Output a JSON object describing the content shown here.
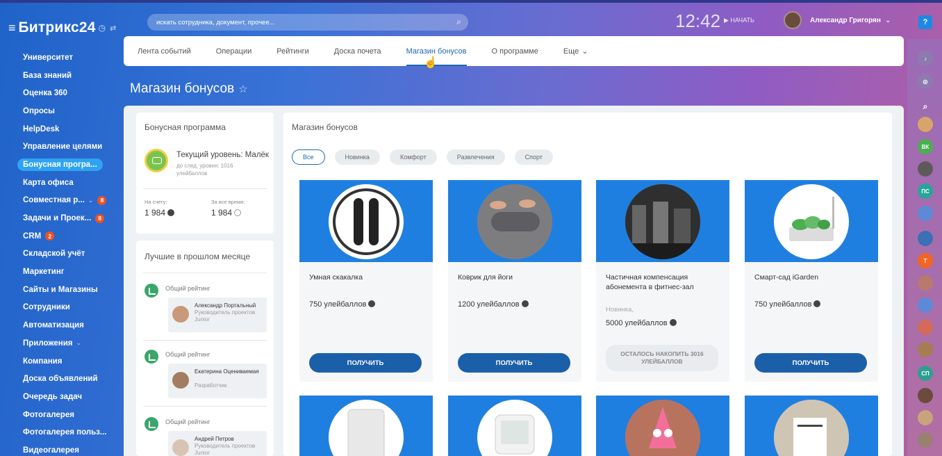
{
  "app": {
    "brand": "Битрикс24",
    "time": "12:42",
    "start_label": "НАЧАТЬ",
    "user_name": "Александр Григорян"
  },
  "search": {
    "placeholder": "искать сотрудника, документ, прочее..."
  },
  "sidebar": {
    "items": [
      {
        "label": "Университет"
      },
      {
        "label": "База знаний"
      },
      {
        "label": "Оценка 360"
      },
      {
        "label": "Опросы"
      },
      {
        "label": "HelpDesk"
      },
      {
        "label": "Управление целями"
      },
      {
        "label": "Бонусная програ..."
      },
      {
        "label": "Карта офиса"
      },
      {
        "label": "Совместная р...",
        "badge": "8"
      },
      {
        "label": "Задачи и Проек...",
        "badge": "8"
      },
      {
        "label": "CRM",
        "badge": "2"
      },
      {
        "label": "Складской учёт"
      },
      {
        "label": "Маркетинг"
      },
      {
        "label": "Сайты и Магазины"
      },
      {
        "label": "Сотрудники"
      },
      {
        "label": "Автоматизация"
      },
      {
        "label": "Приложения"
      },
      {
        "label": "Компания"
      },
      {
        "label": "Доска объявлений"
      },
      {
        "label": "Очередь задач"
      },
      {
        "label": "Фотогалерея"
      },
      {
        "label": "Фотогалерея польз..."
      },
      {
        "label": "Видеогалерея"
      }
    ]
  },
  "tabs": [
    "Лента событий",
    "Операции",
    "Рейтинги",
    "Доска почета",
    "Магазин бонусов",
    "О программе",
    "Еще"
  ],
  "page_title": "Магазин бонусов",
  "bonus": {
    "title": "Бонусная программа",
    "level": "Текущий уровень: Малёк",
    "level_sub": "до след. уровня: 1016 улейбаллов",
    "balance_label": "На счету:",
    "balance": "1 984",
    "total_label": "За все время:",
    "total": "1 984"
  },
  "best": {
    "title": "Лучшие в прошлом месяце",
    "items": [
      {
        "type": "Общий рейтинг",
        "name": "Александр Портальный",
        "position": "Руководитель проектов Junior"
      },
      {
        "type": "Общий рейтинг",
        "name": "Екатерина Оцениваемая",
        "position": "Разработчик"
      },
      {
        "type": "Общий рейтинг",
        "name": "Андрей Петров",
        "position": "Руководитель проектов Junior"
      }
    ]
  },
  "shop": {
    "title": "Магазин бонусов",
    "filters": [
      "Все",
      "Новинка",
      "Комфорт",
      "Развлечения",
      "Спорт"
    ],
    "products": [
      {
        "name": "Умная скакалка",
        "price": "750 улейбаллов",
        "button": "ПОЛУЧИТЬ"
      },
      {
        "name": "Коврик для йоги",
        "price": "1200 улейбаллов",
        "button": "ПОЛУЧИТЬ"
      },
      {
        "name": "Частичная компенсация абонемента в фитнес-зал",
        "tag": "Новинка,",
        "price": "5000 улейбаллов",
        "button": "ОСТАЛОСЬ НАКОПИТЬ 3016 УЛЕЙБАЛЛОВ"
      },
      {
        "name": "Смарт-сад iGarden",
        "price": "750 улейбаллов",
        "button": "ПОЛУЧИТЬ"
      }
    ]
  },
  "rail_labels": [
    "ВК",
    "ПС",
    "Т",
    "СП"
  ]
}
